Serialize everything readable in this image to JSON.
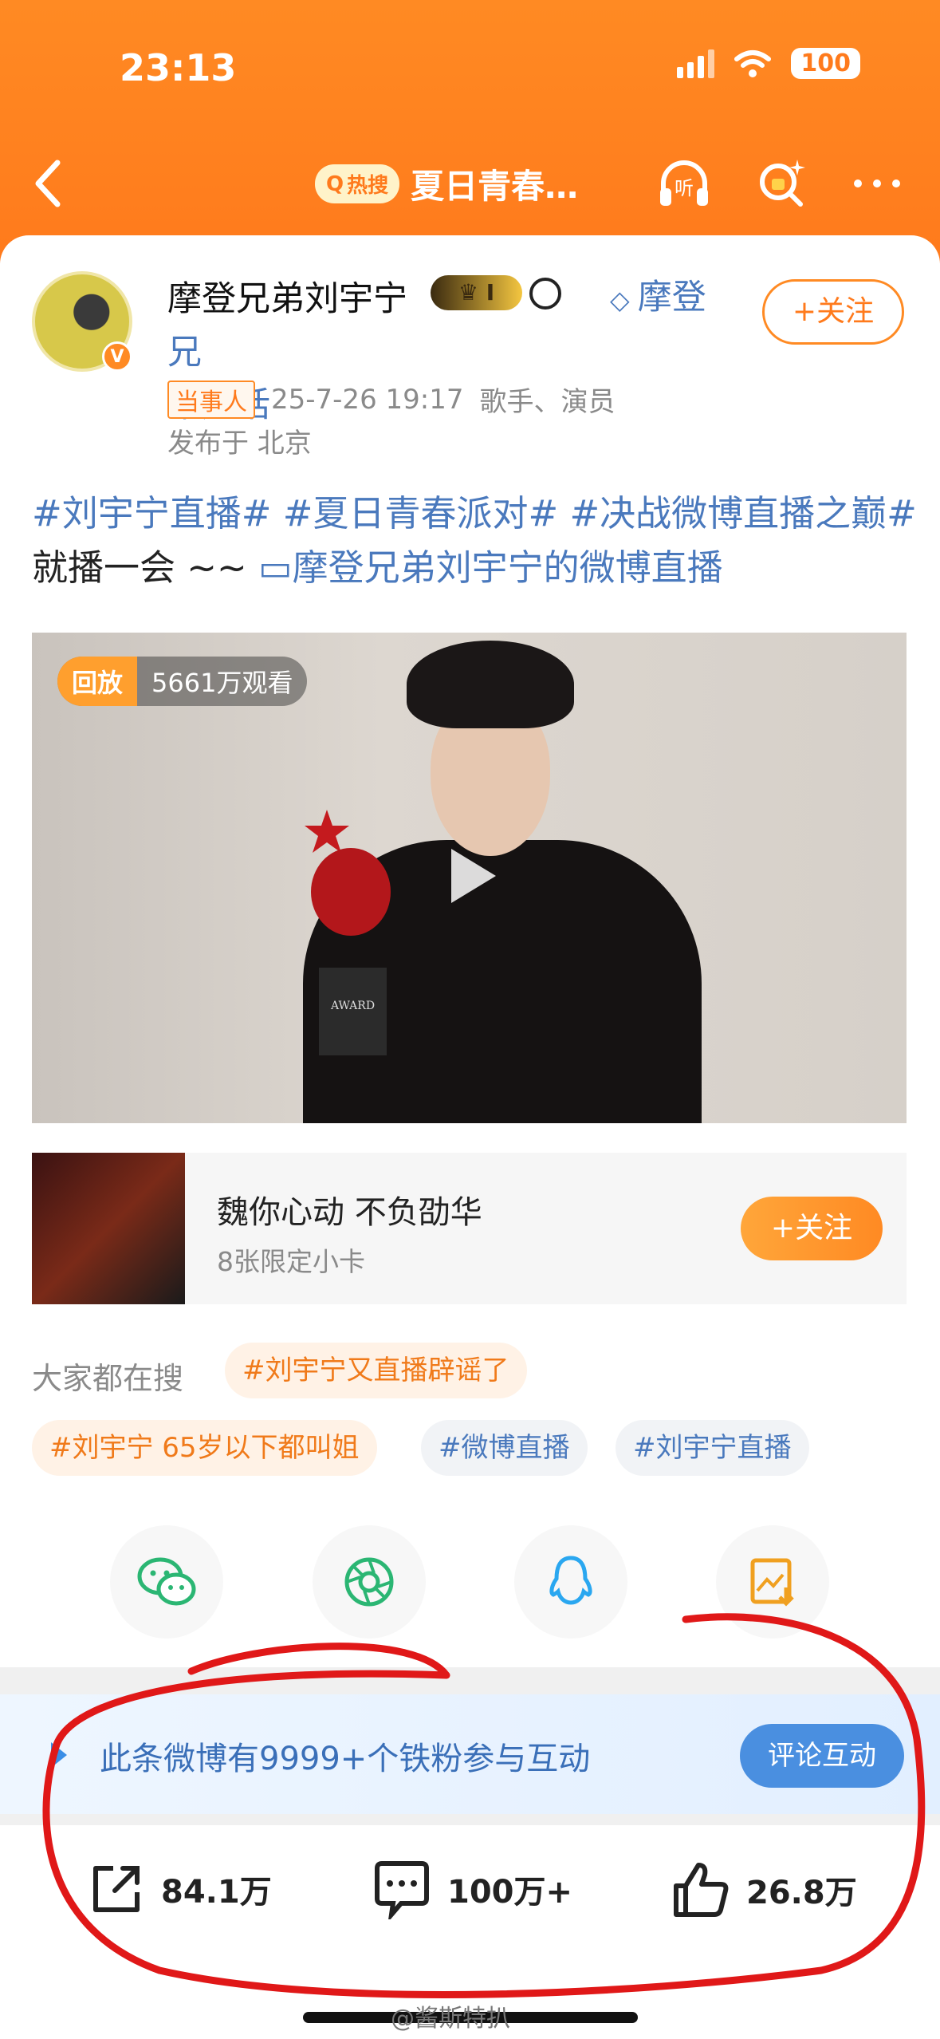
{
  "status_bar": {
    "time": "23:13",
    "battery": "100"
  },
  "nav": {
    "hot_badge": "热搜",
    "title": "夏日青春…",
    "listen_label": "听"
  },
  "post": {
    "username": "摩登兄弟刘宇宁",
    "crown_level": "I",
    "chaohua_line1": "摩登兄",
    "chaohua_line2": "弟超话",
    "follow_label": "+关注",
    "badge_tag": "当事人",
    "datetime": "25-7-26 19:17",
    "role": "歌手、演员",
    "location": "发布于 北京",
    "tags": [
      "#刘宇宁直播#",
      "#夏日青春派对#",
      "#决战微博直播之巅#"
    ],
    "text": "就播一会 ~~",
    "live_link": "摩登兄弟刘宇宁的微博直播"
  },
  "video": {
    "replay_label": "回放",
    "views": "5661万观看",
    "trophy_text": "AWARD"
  },
  "ad": {
    "title": "魏你心动 不负劭华",
    "subtitle": "8张限定小卡",
    "follow_label": "+关注"
  },
  "search": {
    "label": "大家都在搜",
    "chips": [
      "#刘宇宁又直播辟谣了",
      "#刘宇宁 65岁以下都叫姐",
      "#微博直播",
      "#刘宇宁直播"
    ]
  },
  "share": {
    "icons": [
      "wechat-icon",
      "moments-icon",
      "qq-icon",
      "save-image-icon"
    ]
  },
  "fans": {
    "text": "此条微博有9999+个铁粉参与互动",
    "button": "评论互动"
  },
  "actions": {
    "reposts": "84.1万",
    "comments": "100万+",
    "likes": "26.8万"
  },
  "watermark": "@酱斯特扒",
  "colors": {
    "brand_orange": "#ff7a1c",
    "link_blue": "#4a79bd",
    "annotation_red": "#e01818"
  }
}
